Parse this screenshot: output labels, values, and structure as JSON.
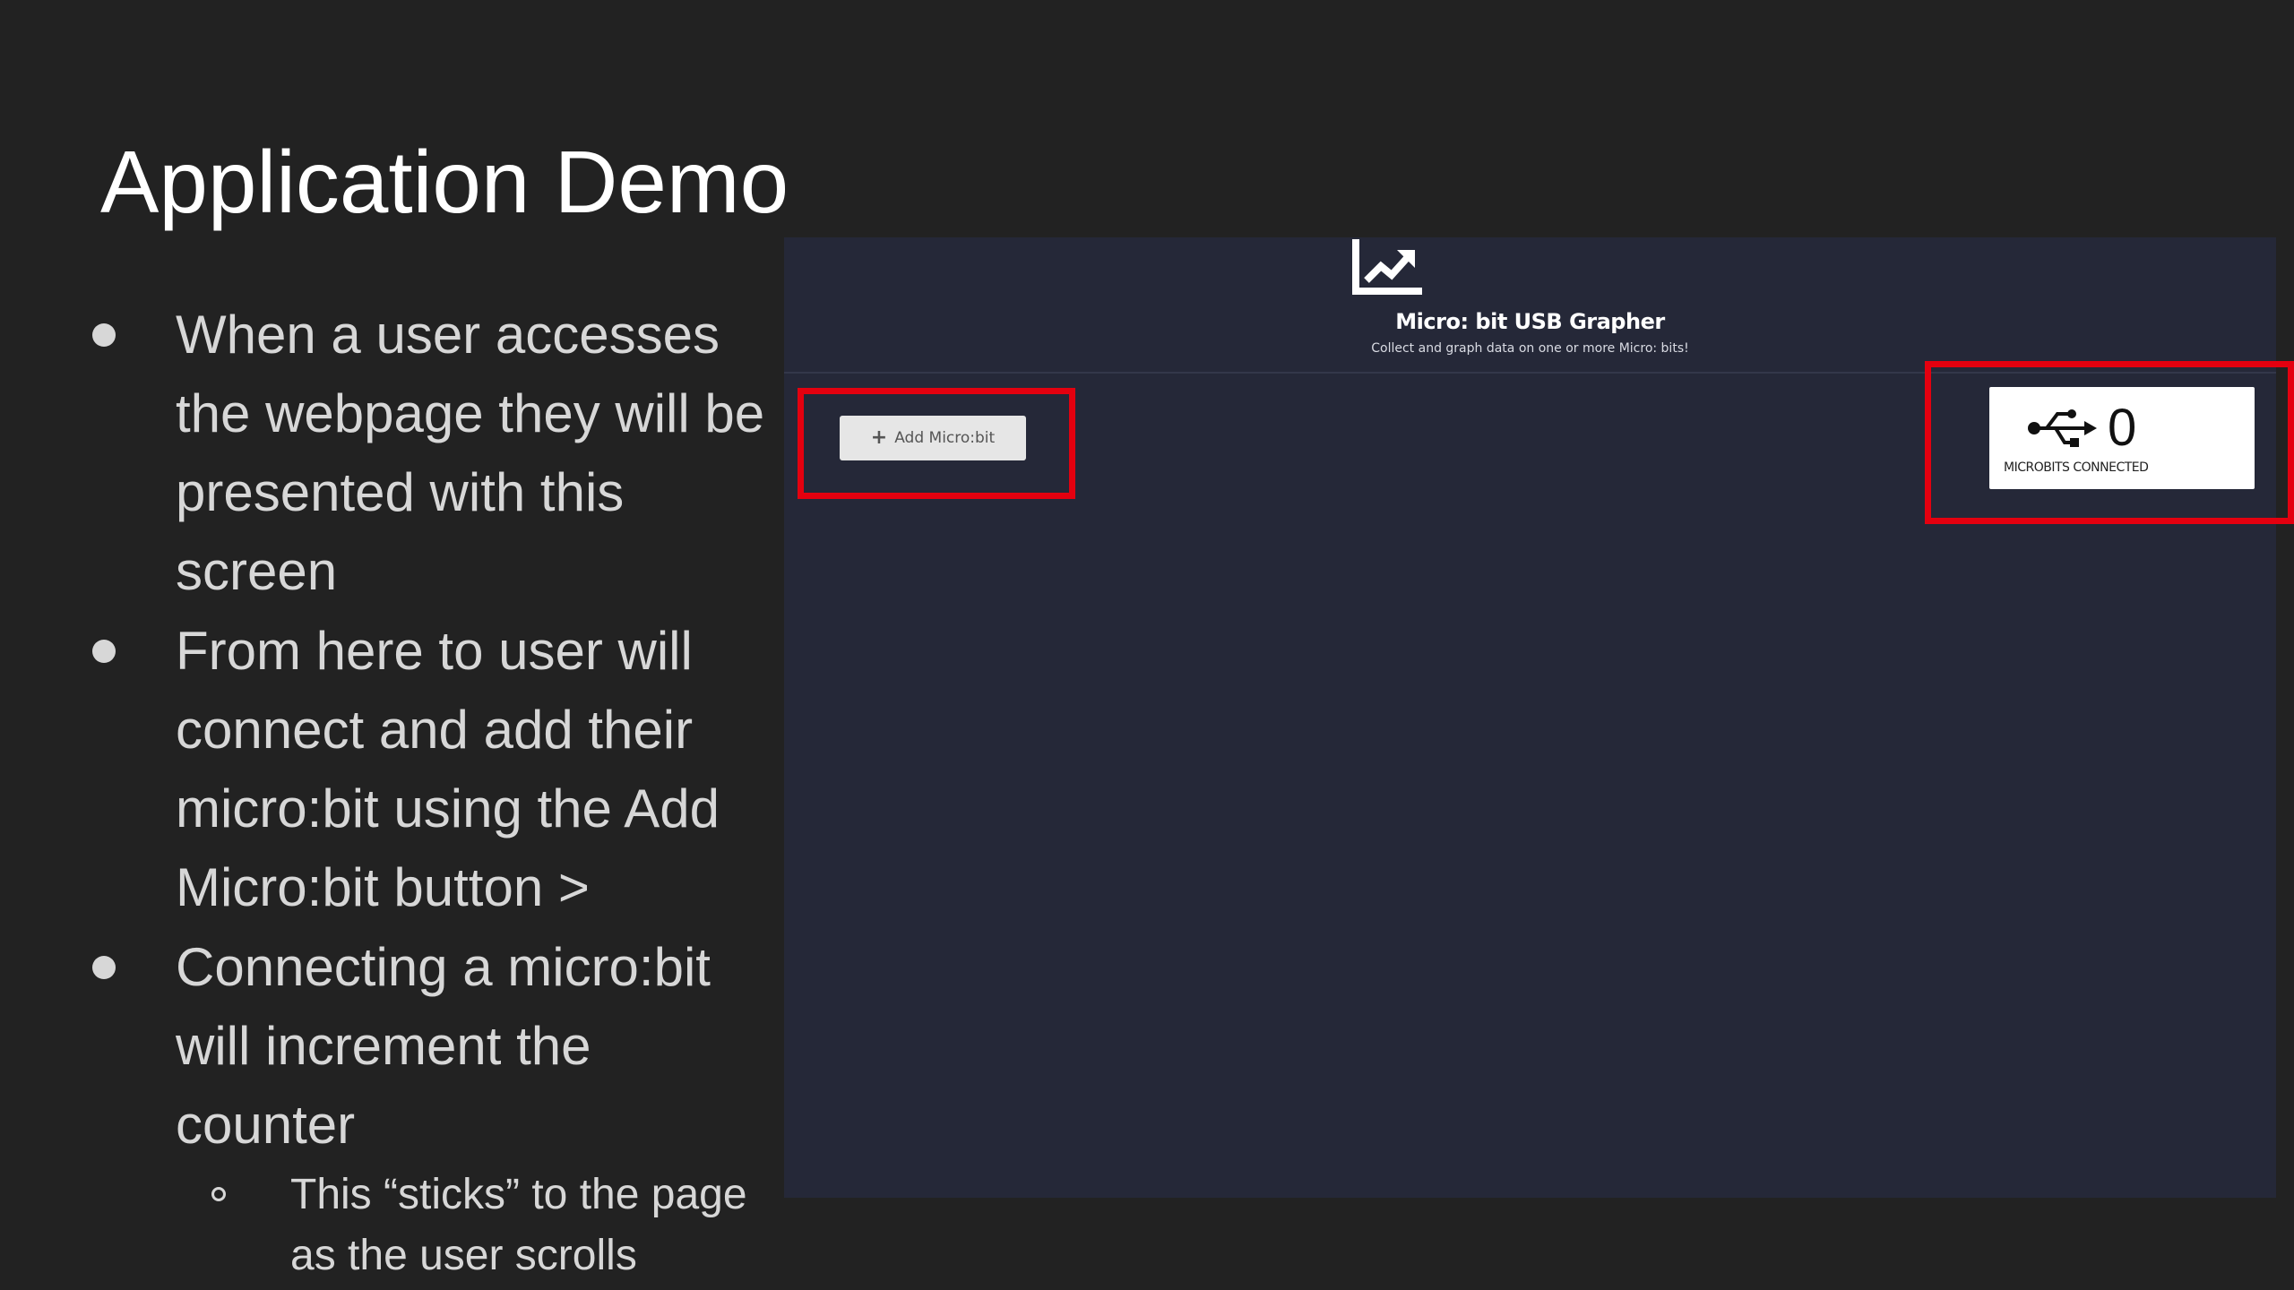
{
  "slide": {
    "title": "Application Demo",
    "bullets": [
      "When a user accesses the webpage they will be presented with this screen",
      "From here to user will connect and add their micro:bit using the Add Micro:bit button >",
      "Connecting a micro:bit will increment the counter"
    ],
    "sub_bullets": [
      "This “sticks” to the page as the user scrolls"
    ]
  },
  "app": {
    "logo_icon": "chart-line-icon",
    "title": "Micro: bit USB Grapher",
    "subtitle": "Collect and graph data on one or more Micro: bits!",
    "add_button": {
      "icon": "plus-icon",
      "label": "Add Micro:bit"
    },
    "counter": {
      "icon": "usb-icon",
      "value": "0",
      "label": "MICROBITS CONNECTED"
    }
  },
  "annotations": {
    "highlight_color": "#e4000f"
  },
  "colors": {
    "slide_background": "#222222",
    "app_background": "#252838",
    "text_primary": "#ffffff",
    "text_bullets": "#d7d7d7"
  }
}
